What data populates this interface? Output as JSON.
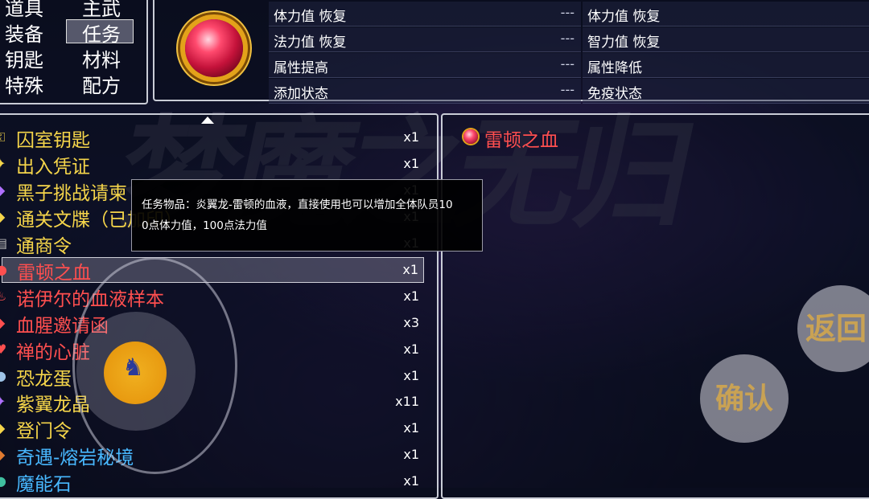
{
  "background_title": "梦魔之无归",
  "categories": [
    {
      "label": "道具"
    },
    {
      "label": "主武"
    },
    {
      "label": "装备"
    },
    {
      "label": "任务"
    },
    {
      "label": "钥匙"
    },
    {
      "label": "材料"
    },
    {
      "label": "特殊"
    },
    {
      "label": "配方"
    }
  ],
  "selected_category": "任务",
  "stats": {
    "left": [
      {
        "label": "体力值 恢复",
        "value": "---"
      },
      {
        "label": "法力值 恢复",
        "value": "---"
      },
      {
        "label": "属性提高",
        "value": "---"
      },
      {
        "label": "添加状态",
        "value": "---"
      }
    ],
    "right": [
      {
        "label": "体力值 恢复",
        "value": ""
      },
      {
        "label": "智力值 恢复",
        "value": ""
      },
      {
        "label": "属性降低",
        "value": ""
      },
      {
        "label": "免疫状态",
        "value": ""
      }
    ]
  },
  "items": [
    {
      "name": "囚室钥匙",
      "count": "x1",
      "color": "gold",
      "icon": "key-icon"
    },
    {
      "name": "出入凭证",
      "count": "x1",
      "color": "gold",
      "icon": "pass-icon"
    },
    {
      "name": "黑子挑战请柬",
      "count": "x1",
      "color": "gold",
      "icon": "crystal-icon"
    },
    {
      "name": "通关文牒（已加印）",
      "count": "x1",
      "color": "gold",
      "icon": "document-icon"
    },
    {
      "name": "通商令",
      "count": "x1",
      "color": "gold",
      "icon": "token-icon"
    },
    {
      "name": "雷顿之血",
      "count": "x1",
      "color": "red",
      "icon": "blood-orb-icon"
    },
    {
      "name": "诺伊尔的血液样本",
      "count": "x1",
      "color": "red",
      "icon": "vial-icon"
    },
    {
      "name": "血腥邀请函",
      "count": "x3",
      "color": "red",
      "icon": "letter-icon"
    },
    {
      "name": "禅的心脏",
      "count": "x1",
      "color": "red",
      "icon": "heart-icon"
    },
    {
      "name": "恐龙蛋",
      "count": "x1",
      "color": "gold",
      "icon": "egg-icon"
    },
    {
      "name": "紫翼龙晶",
      "count": "x11",
      "color": "gold",
      "icon": "crystal-icon"
    },
    {
      "name": "登门令",
      "count": "x1",
      "color": "gold",
      "icon": "token-icon"
    },
    {
      "name": "奇遇-熔岩秘境",
      "count": "x1",
      "color": "cyan",
      "icon": "map-icon"
    },
    {
      "name": "魔能石",
      "count": "x1",
      "color": "cyan",
      "icon": "stone-icon"
    }
  ],
  "selected_item": {
    "name": "雷顿之血"
  },
  "tooltip": {
    "line1": "任务物品：炎翼龙-雷顿的血液，直接使用也可以增加全体队员10",
    "line2": "0点体力值，100点法力值"
  },
  "buttons": {
    "back": "返回",
    "confirm": "确认"
  },
  "colors": {
    "gold": "#f5d54a",
    "red": "#ff4f4f",
    "cyan": "#48b8ff"
  }
}
